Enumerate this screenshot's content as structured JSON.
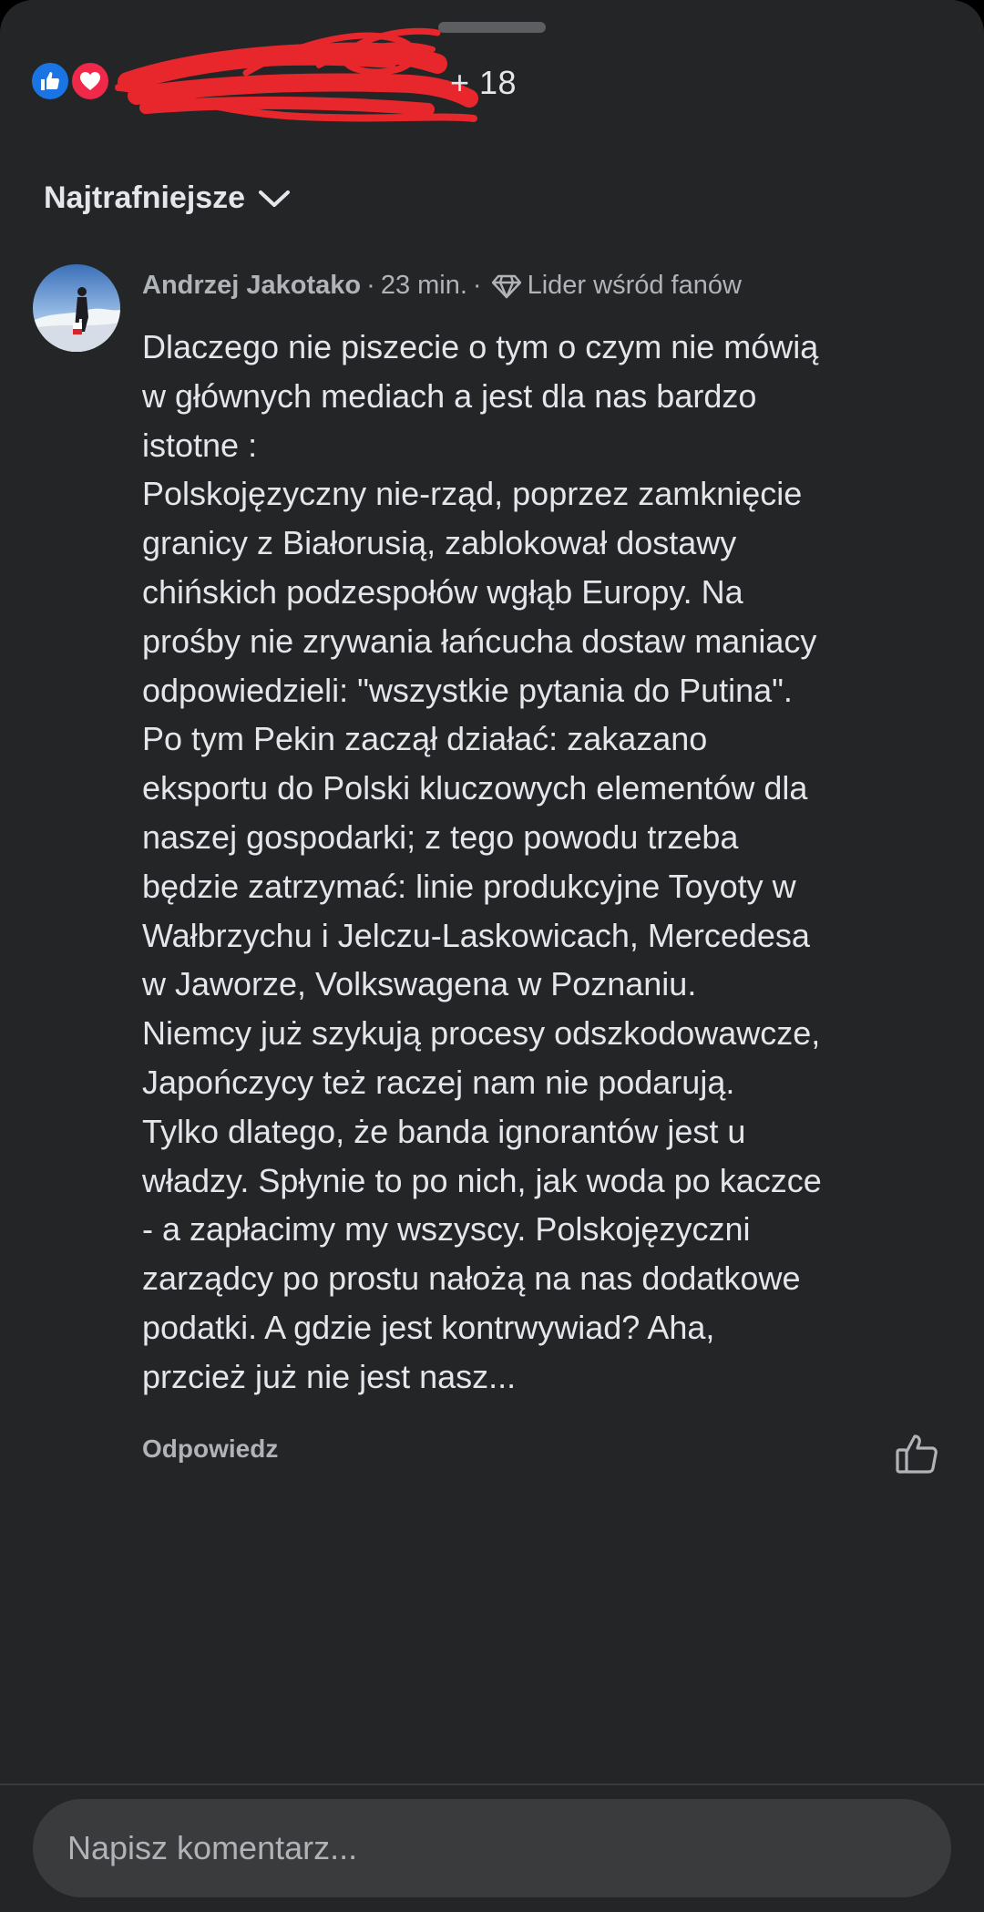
{
  "header": {
    "reaction_count": "+ 18",
    "reaction_icons": [
      "like-icon",
      "love-icon"
    ],
    "sort_label": "Najtrafniejsze"
  },
  "comment": {
    "author": "Andrzej Jakotako",
    "time": "23 min.",
    "badge": "Lider wśród fanów",
    "badge_icon": "diamond-icon",
    "lines": [
      "Dlaczego nie piszecie o tym o czym nie mówią",
      "w głównych mediach a jest dla nas bardzo",
      "istotne :",
      "Polskojęzyczny nie-rząd, poprzez zamknięcie",
      "granicy z Białorusią, zablokował dostawy",
      "chińskich podzespołów wgłąb Europy. Na",
      "prośby nie zrywania łańcucha dostaw maniacy",
      "odpowiedzieli: \"wszystkie pytania do Putina\".",
      "Po tym Pekin zaczął działać: zakazano",
      "eksportu do Polski kluczowych elementów dla",
      "naszej gospodarki; z tego powodu trzeba",
      "będzie zatrzymać: linie produkcyjne Toyoty w",
      "Wałbrzychu i Jelczu-Laskowicach, Mercedesa",
      "w Jaworze, Volkswagena w Poznaniu.",
      "Niemcy już szykują procesy odszkodowawcze,",
      "Japończycy też raczej nam nie podarują.",
      "Tylko dlatego, że banda ignorantów jest u",
      "władzy. Spłynie to po nich, jak woda po kaczce",
      "- a zapłacimy my wszyscy. Polskojęzyczni",
      "zarządcy po prostu nałożą na nas dodatkowe",
      "podatki. A gdzie jest kontrwywiad? Aha,",
      "przcież już nie jest nasz..."
    ],
    "reply_label": "Odpowiedz"
  },
  "composer": {
    "placeholder": "Napisz komentarz..."
  },
  "colors": {
    "sheet_bg": "#242526",
    "text_primary": "#e4e6eb",
    "text_secondary": "#b0b3b8",
    "like_blue": "#1b74e4",
    "love_red": "#f0284a",
    "redaction": "#e8272c"
  }
}
